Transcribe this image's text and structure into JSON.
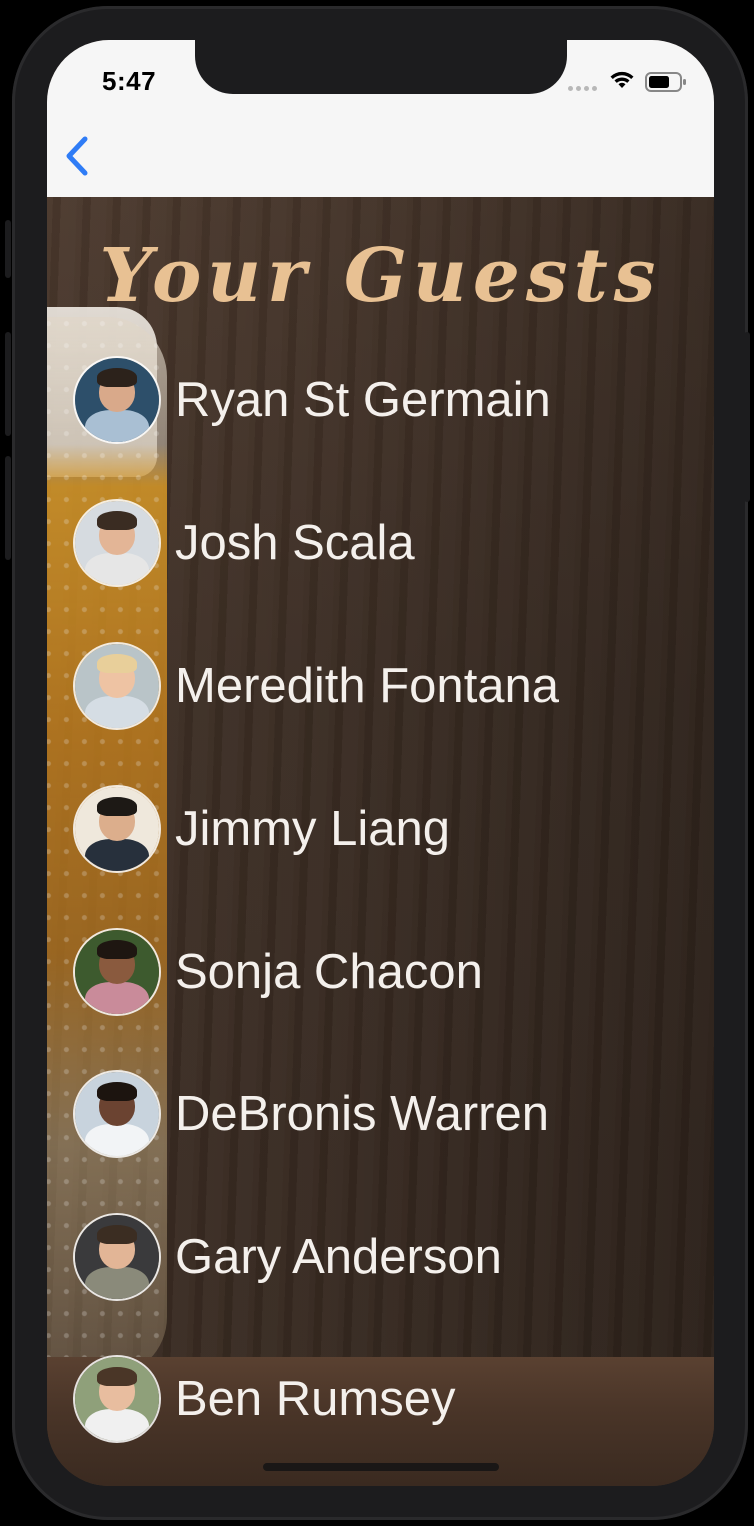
{
  "status_bar": {
    "time": "5:47",
    "icons": [
      "cellular-signal-icon",
      "wifi-icon",
      "battery-icon"
    ]
  },
  "nav": {
    "back_icon": "chevron-left-icon",
    "accent": "#2f7cf6"
  },
  "screen": {
    "title": "Your Guests",
    "title_color": "#e8c193"
  },
  "guests": [
    {
      "name": "Ryan St Germain",
      "avatar_bg": "#2d4f6a",
      "skin": "#d9a98a",
      "hair": "#2c221b",
      "shirt": "#a9bfd3"
    },
    {
      "name": "Josh Scala",
      "avatar_bg": "#d6dbe0",
      "skin": "#e3b596",
      "hair": "#3a2c22",
      "shirt": "#e6e6e6"
    },
    {
      "name": "Meredith Fontana",
      "avatar_bg": "#b9c4c8",
      "skin": "#eec3a3",
      "hair": "#e8cf9a",
      "shirt": "#d5dde4"
    },
    {
      "name": "Jimmy Liang",
      "avatar_bg": "#efe8dc",
      "skin": "#dcae8c",
      "hair": "#1d1915",
      "shirt": "#27303c"
    },
    {
      "name": "Sonja Chacon",
      "avatar_bg": "#3d5a2e",
      "skin": "#8a5a3e",
      "hair": "#1e1611",
      "shirt": "#c98b9a"
    },
    {
      "name": "DeBronis Warren",
      "avatar_bg": "#c8d3dd",
      "skin": "#6b4331",
      "hair": "#1c140f",
      "shirt": "#f2f4f6"
    },
    {
      "name": "Gary Anderson",
      "avatar_bg": "#3a3a3c",
      "skin": "#e2b596",
      "hair": "#3b2d22",
      "shirt": "#8a8a7a"
    },
    {
      "name": "Ben Rumsey",
      "avatar_bg": "#8fa07a",
      "skin": "#e8bd9f",
      "hair": "#4a3627",
      "shirt": "#f0f0f0"
    }
  ]
}
